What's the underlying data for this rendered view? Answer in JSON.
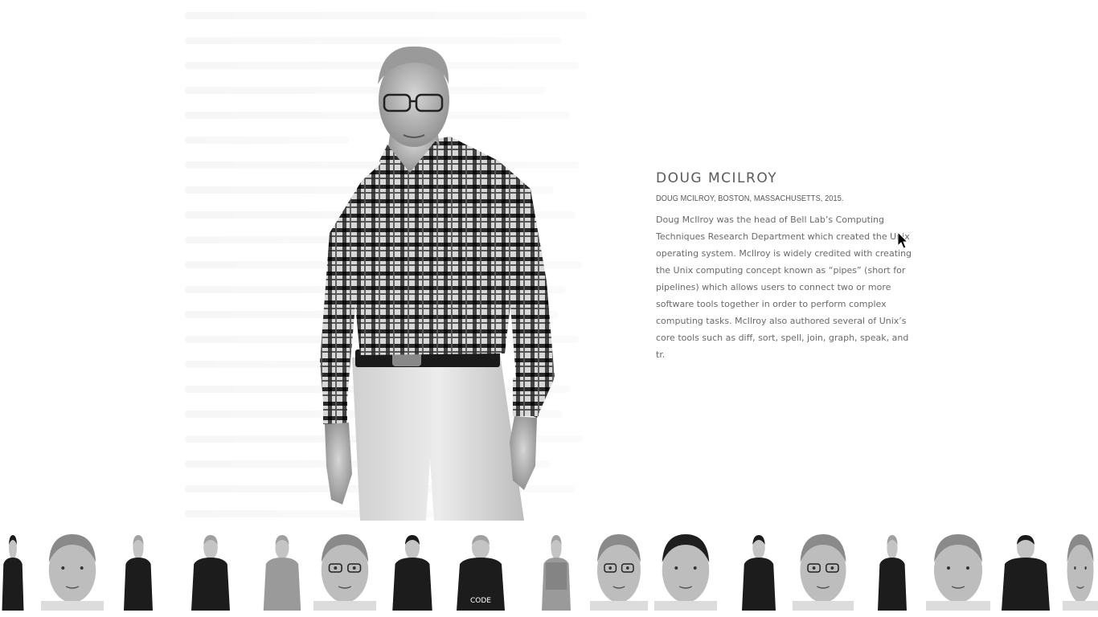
{
  "profile": {
    "name": "DOUG MCILROY",
    "subtitle": "DOUG MCILROY, BOSTON, MASSACHUSETTS, 2015.",
    "bio": "Doug McIlroy was the head of Bell Lab’s Computing Techniques Research Department which created the Unix operating system. McIlroy is widely credited with creating the Unix computing concept known as “pipes” (short for pipelines) which allows users to connect two or more software tools together in order to perform complex computing tasks. McIlroy also authored several of Unix’s core tools such as diff, sort, spell, join, graph, speak, and tr."
  },
  "portrait": {
    "icon": "portrait-photo",
    "tone": "black-and-white"
  },
  "thumbnails": [
    {
      "icon": "portrait-thumbnail",
      "style": "suit-full"
    },
    {
      "icon": "portrait-thumbnail",
      "style": "face-close"
    },
    {
      "icon": "portrait-thumbnail",
      "style": "jacket-blonde"
    },
    {
      "icon": "portrait-thumbnail",
      "style": "jacket-blonde"
    },
    {
      "icon": "portrait-thumbnail",
      "style": "old-man-hand"
    },
    {
      "icon": "portrait-thumbnail",
      "style": "glasses-face"
    },
    {
      "icon": "portrait-thumbnail",
      "style": "dark-hair-woman"
    },
    {
      "icon": "portrait-thumbnail",
      "style": "code-shirt"
    },
    {
      "icon": "portrait-thumbnail",
      "style": "plaid-man"
    },
    {
      "icon": "portrait-thumbnail",
      "style": "glasses-face"
    },
    {
      "icon": "portrait-thumbnail",
      "style": "woman-face"
    },
    {
      "icon": "portrait-thumbnail",
      "style": "man-dark"
    },
    {
      "icon": "portrait-thumbnail",
      "style": "glasses-face"
    },
    {
      "icon": "portrait-thumbnail",
      "style": "woman-standing"
    },
    {
      "icon": "portrait-thumbnail",
      "style": "blonde-face"
    },
    {
      "icon": "portrait-thumbnail",
      "style": "man-hoodie"
    },
    {
      "icon": "portrait-thumbnail",
      "style": "face-close"
    }
  ],
  "colors": {
    "background": "#ffffff",
    "name_text": "#5a5a5a",
    "body_text": "#6a6a6a"
  }
}
